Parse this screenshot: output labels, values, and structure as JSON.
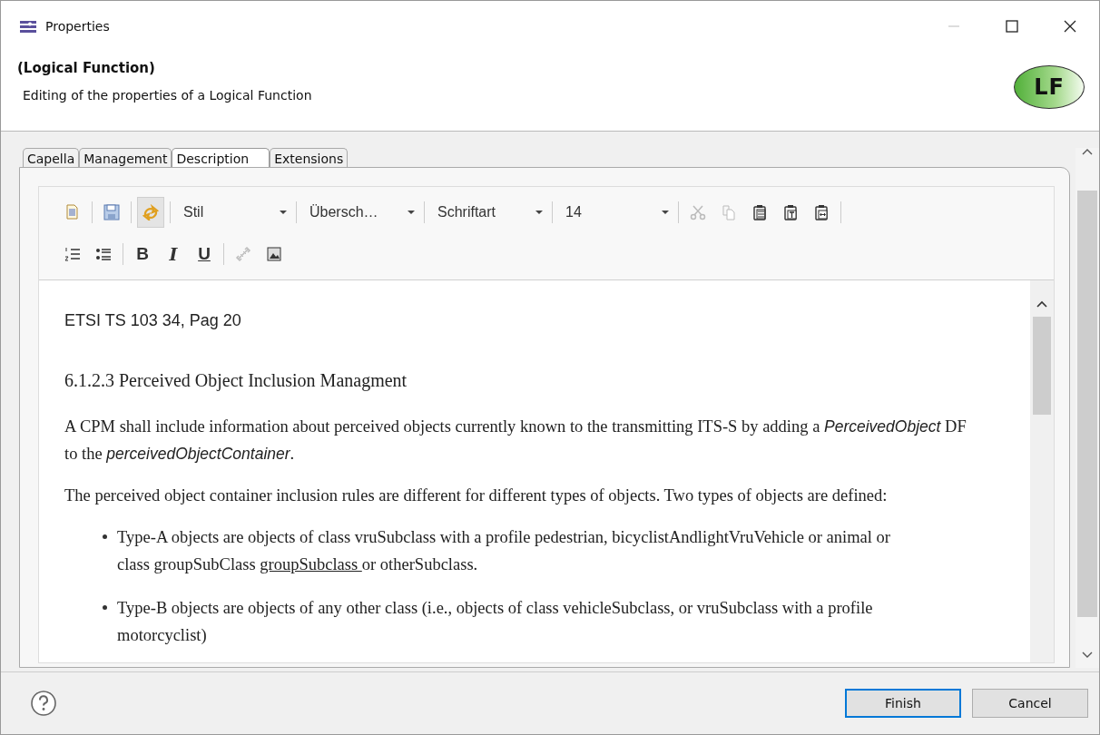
{
  "window": {
    "title": "Properties"
  },
  "header": {
    "title": "(Logical Function)",
    "subtitle": "Editing of the properties of a Logical Function",
    "badge": "LF"
  },
  "tabs": [
    {
      "label": "Capella",
      "selected": false
    },
    {
      "label": "Management",
      "selected": false
    },
    {
      "label": "Description",
      "selected": true
    },
    {
      "label": "Extensions",
      "selected": false
    }
  ],
  "toolbar": {
    "rows": [
      [
        {
          "kind": "document",
          "disabled": false,
          "pressed": false
        },
        {
          "kind": "separator"
        },
        {
          "kind": "save",
          "disabled": false,
          "pressed": false
        },
        {
          "kind": "separator"
        },
        {
          "kind": "sync",
          "disabled": false,
          "pressed": true
        },
        {
          "kind": "separator"
        },
        {
          "kind": "combo",
          "value": "Stil",
          "wide": true
        },
        {
          "kind": "separator"
        },
        {
          "kind": "combo",
          "value": "Übersch…",
          "wide": false
        },
        {
          "kind": "separator"
        },
        {
          "kind": "combo",
          "value": "Schriftart",
          "wide": false
        },
        {
          "kind": "separator"
        },
        {
          "kind": "combo",
          "value": "14",
          "wide": true
        },
        {
          "kind": "separator"
        },
        {
          "kind": "cut",
          "disabled": true,
          "pressed": false
        },
        {
          "kind": "copy",
          "disabled": true,
          "pressed": false
        },
        {
          "kind": "paste",
          "disabled": false,
          "pressed": false
        },
        {
          "kind": "paste-text",
          "disabled": false,
          "pressed": false
        },
        {
          "kind": "paste-special",
          "disabled": false,
          "pressed": false
        },
        {
          "kind": "separator"
        }
      ],
      [
        {
          "kind": "numbered-list",
          "disabled": false,
          "pressed": false
        },
        {
          "kind": "bullet-list",
          "disabled": false,
          "pressed": false
        },
        {
          "kind": "separator"
        },
        {
          "kind": "bold",
          "label": "B",
          "disabled": false,
          "pressed": false
        },
        {
          "kind": "italic",
          "label": "I",
          "disabled": false,
          "pressed": false
        },
        {
          "kind": "underline",
          "label": "U",
          "disabled": false,
          "pressed": false
        },
        {
          "kind": "separator"
        },
        {
          "kind": "link",
          "disabled": true,
          "pressed": false
        },
        {
          "kind": "image",
          "disabled": false,
          "pressed": false
        }
      ]
    ]
  },
  "document": [
    {
      "kind": "plain",
      "text": "ETSI TS 103 34, Pag 20"
    },
    {
      "kind": "heading",
      "text": "6.1.2.3 Perceived Object Inclusion Managment"
    },
    {
      "kind": "paragraph",
      "text": "A CPM shall include information about perceived objects currently known to the transmitting ITS-S by adding a *PerceivedObject* DF to the *perceivedObjectContainer*."
    },
    {
      "kind": "paragraph",
      "text": "The perceived object container inclusion rules are different for different types of objects. Two types of objects are defined:"
    },
    {
      "kind": "bullet",
      "segments": [
        {
          "text": "Type-A objects are objects of class vruSubclass with a profile pedestrian, bicyclistAndlightVruVehicle or animal or class groupSubClass ",
          "underline": false
        },
        {
          "text": "groupSubclass ",
          "underline": true
        },
        {
          "text": "or otherSubclass.",
          "underline": false
        }
      ]
    },
    {
      "kind": "bullet",
      "segments": [
        {
          "text": "Type-B objects are objects of any other class (i.e., objects of class vehicleSubclass, or vruSubclass with a profile motorcyclist)",
          "underline": false
        }
      ]
    }
  ],
  "buttons": [
    {
      "label": "Finish",
      "default": true
    },
    {
      "label": "Cancel",
      "default": false
    }
  ]
}
